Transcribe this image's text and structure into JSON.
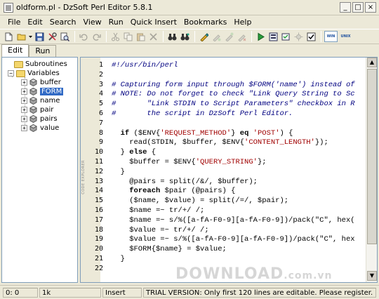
{
  "window": {
    "title": "oldform.pl - DzSoft Perl Editor 5.8.1",
    "controls": {
      "minimize": "_",
      "maximize": "□",
      "close": "×"
    }
  },
  "menu": [
    "File",
    "Edit",
    "Search",
    "View",
    "Run",
    "Quick Insert",
    "Bookmarks",
    "Help"
  ],
  "toolbar": {
    "icons": [
      "new-file-icon",
      "open-folder-icon",
      "dropdown-arrow-icon",
      "save-icon",
      "tools-icon",
      "find-icon",
      "undo-icon",
      "redo-icon",
      "cut-icon",
      "copy-icon",
      "paste-icon",
      "delete-icon",
      "find-binoculars-icon",
      "find-next-icon",
      "toggle-bookmark-icon",
      "prev-bookmark-icon",
      "next-bookmark-icon",
      "clear-bookmarks-icon",
      "run-icon",
      "run-debug-icon",
      "syntax-check-icon",
      "settings-icon",
      "checkbox-icon"
    ],
    "eol_windows": "WIN",
    "eol_unix": "UNIX"
  },
  "tabs": [
    "Edit",
    "Run"
  ],
  "tree": {
    "subroutines": "Subroutines",
    "variables": "Variables",
    "items": [
      "buffer",
      "FORM",
      "name",
      "pair",
      "pairs",
      "value"
    ],
    "selected": "FORM"
  },
  "editor": {
    "fold_label": "CODE EXPLORER",
    "line_numbers": [
      "1",
      "2",
      "3",
      "4",
      "5",
      "6",
      "7",
      "8",
      "9",
      "10",
      "11",
      "12",
      "13",
      "14",
      "15",
      "16",
      "17",
      "18",
      "19",
      "20",
      "21",
      "22"
    ],
    "lines": [
      [
        {
          "t": "#!/usr/bin/perl",
          "c": "comment"
        }
      ],
      [],
      [
        {
          "t": "# Capturing form input through $FORM('name') instead of",
          "c": "comment"
        }
      ],
      [
        {
          "t": "# NOTE: Do not forget to check \"Link Query String to Sc",
          "c": "comment"
        }
      ],
      [
        {
          "t": "#       \"Link STDIN to Script Parameters\" checkbox in R",
          "c": "comment"
        }
      ],
      [
        {
          "t": "#       the script in DzSoft Perl Editor.",
          "c": "comment"
        }
      ],
      [],
      [
        {
          "t": "  "
        },
        {
          "t": "if",
          "c": "kw"
        },
        {
          "t": " ($ENV{"
        },
        {
          "t": "'REQUEST_METHOD'",
          "c": "str"
        },
        {
          "t": "} "
        },
        {
          "t": "eq",
          "c": "kw"
        },
        {
          "t": " "
        },
        {
          "t": "'POST'",
          "c": "str"
        },
        {
          "t": ") {"
        }
      ],
      [
        {
          "t": "    read(STDIN, $buffer, $ENV{"
        },
        {
          "t": "'CONTENT_LENGTH'",
          "c": "str"
        },
        {
          "t": "});"
        }
      ],
      [
        {
          "t": "  } "
        },
        {
          "t": "else",
          "c": "kw"
        },
        {
          "t": " {"
        }
      ],
      [
        {
          "t": "    $buffer = $ENV{"
        },
        {
          "t": "'QUERY_STRING'",
          "c": "str"
        },
        {
          "t": "};"
        }
      ],
      [
        {
          "t": "  }"
        }
      ],
      [
        {
          "t": "    @pairs = split(/&/, $buffer);"
        }
      ],
      [
        {
          "t": "    "
        },
        {
          "t": "foreach",
          "c": "kw"
        },
        {
          "t": " $pair (@pairs) {"
        }
      ],
      [
        {
          "t": "    ($name, $value) = split(/=/, $pair);"
        }
      ],
      [
        {
          "t": "    $name =~ tr/+/ /;"
        }
      ],
      [
        {
          "t": "    $name =~ s/%([a-fA-F0-9][a-fA-F0-9])/pack(\"C\", hex("
        }
      ],
      [
        {
          "t": "    $value =~ tr/+/ /;"
        }
      ],
      [
        {
          "t": "    $value =~ s/%([a-fA-F0-9][a-fA-F0-9])/pack(\"C\", hex"
        }
      ],
      [
        {
          "t": "    $FORM{$name} = $value;"
        }
      ],
      [
        {
          "t": "  }"
        }
      ],
      []
    ]
  },
  "status": {
    "position": "0:   0",
    "size": "1k",
    "mode": "Insert",
    "message": "TRIAL VERSION: Only first 120 lines are editable. Please register."
  },
  "watermark": {
    "main": "DOWNLOAD",
    "suffix": ".com.vn"
  }
}
